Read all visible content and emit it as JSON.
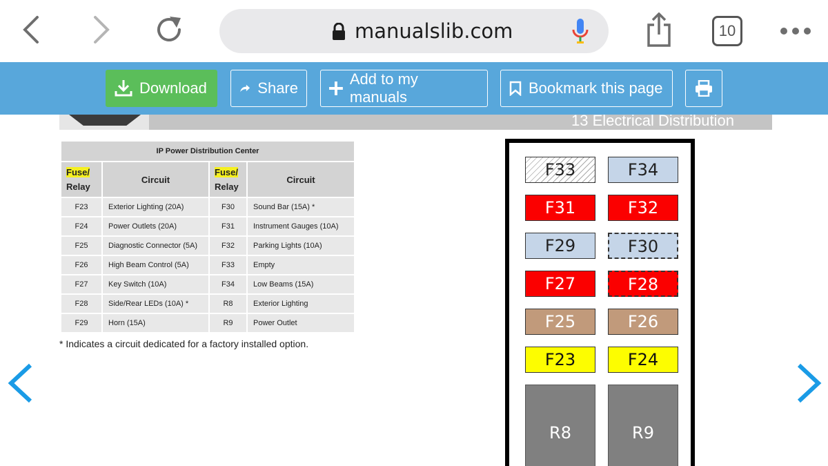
{
  "browser": {
    "url": "manualslib.com",
    "tab_count": "10"
  },
  "toolbar": {
    "download": "Download",
    "share": "Share",
    "add": "Add to my manuals",
    "bookmark": "Bookmark this page"
  },
  "doc": {
    "section_title": "13 Electrical Distribution",
    "table_title": "IP Power Distribution Center",
    "col_fuse_a": "Fuse/",
    "col_relay_a": "Relay",
    "col_circuit_a": "Circuit",
    "col_fuse_b": "Fuse/",
    "col_relay_b": "Relay",
    "col_circuit_b": "Circuit",
    "rows": [
      {
        "id1": "F23",
        "c1": "Exterior Lighting (20A)",
        "id2": "F30",
        "c2": "Sound Bar (15A) *"
      },
      {
        "id1": "F24",
        "c1": "Power Outlets (20A)",
        "id2": "F31",
        "c2": "Instrument Gauges (10A)"
      },
      {
        "id1": "F25",
        "c1": "Diagnostic Connector (5A)",
        "id2": "F32",
        "c2": "Parking Lights (10A)"
      },
      {
        "id1": "F26",
        "c1": "High Beam Control (5A)",
        "id2": "F33",
        "c2": "Empty"
      },
      {
        "id1": "F27",
        "c1": "Key Switch (10A)",
        "id2": "F34",
        "c2": "Low Beams (15A)"
      },
      {
        "id1": "F28",
        "c1": "Side/Rear LEDs (10A) *",
        "id2": "R8",
        "c2": "Exterior Lighting"
      },
      {
        "id1": "F29",
        "c1": "Horn (15A)",
        "id2": "R9",
        "c2": "Power Outlet"
      }
    ],
    "footnote": "* Indicates a circuit dedicated for a factory installed option."
  },
  "fuse_box": {
    "f33": "F33",
    "f34": "F34",
    "f31": "F31",
    "f32": "F32",
    "f29": "F29",
    "f30": "F30",
    "f27": "F27",
    "f28": "F28",
    "f25": "F25",
    "f26": "F26",
    "f23": "F23",
    "f24": "F24",
    "r8": "R8",
    "r9": "R9"
  },
  "colors": {
    "toolbar": "#58a7db",
    "download": "#5bbe5a",
    "fuse_red": "#fb0000",
    "fuse_blue": "#c5d5e8",
    "fuse_tan": "#c19a7b",
    "fuse_yellow": "#fdfd00",
    "relay_gray": "#808080",
    "page_arrow": "#1a9be6"
  }
}
